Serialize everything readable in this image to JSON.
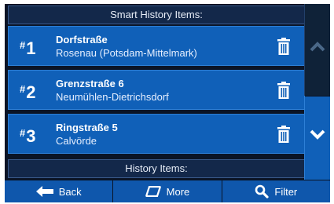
{
  "header": {
    "smart_history_label": "Smart History Items:"
  },
  "items": [
    {
      "rank_hash": "#",
      "rank": "1",
      "title": "Dorfstraße",
      "subtitle": "Rosenau (Potsdam-Mittelmark)"
    },
    {
      "rank_hash": "#",
      "rank": "2",
      "title": "Grenzstraße 6",
      "subtitle": "Neumühlen-Dietrichsdorf"
    },
    {
      "rank_hash": "#",
      "rank": "3",
      "title": "Ringstraße 5",
      "subtitle": "Calvörde"
    }
  ],
  "footer_section": {
    "history_label": "History Items:"
  },
  "bottom_bar": {
    "back_label": "Back",
    "more_label": "More",
    "filter_label": "Filter"
  },
  "icons": {
    "trash": "trash-icon",
    "scroll_up": "chevron-up-icon",
    "scroll_down": "chevron-down-icon",
    "back": "arrow-left-icon",
    "more": "more-icon",
    "filter": "search-icon"
  },
  "colors": {
    "background": "#0a1426",
    "row": "#1060b8",
    "header": "#13284a",
    "button": "#0f57ac",
    "text": "#ffffff"
  }
}
